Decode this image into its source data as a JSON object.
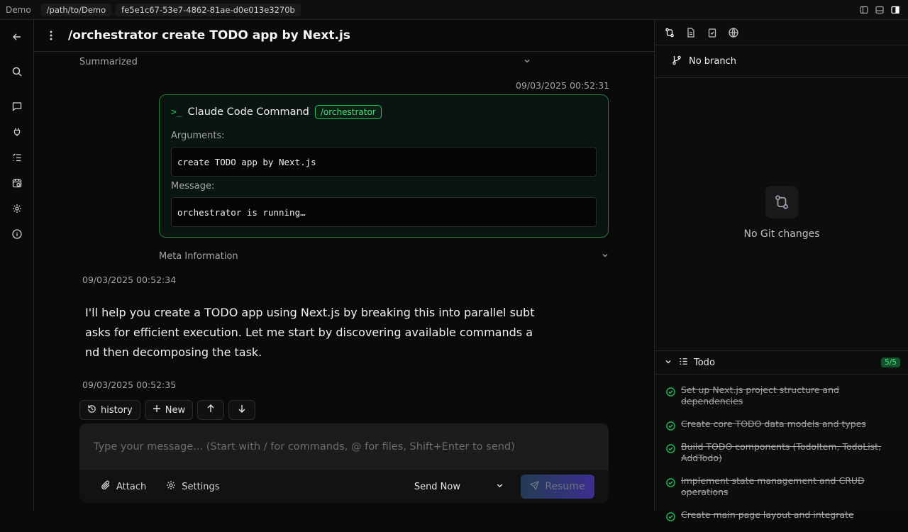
{
  "topbar": {
    "app_name": "Demo",
    "path": "/path/to/Demo",
    "session_id": "fe5e1c67-53e7-4862-81ae-d0e013e3270b"
  },
  "header": {
    "title": "/orchestrator create TODO app by Next.js"
  },
  "thread": {
    "summarized_label": "Summarized",
    "command_timestamp": "09/03/2025 00:52:31",
    "command": {
      "title": "Claude Code Command",
      "badge": "/orchestrator",
      "arguments_label": "Arguments:",
      "arguments": "create TODO app by Next.js",
      "message_label": "Message:",
      "message": "orchestrator is running…"
    },
    "meta_label": "Meta Information",
    "assistant_timestamp": "09/03/2025 00:52:34",
    "assistant_text": "I'll help you create a TODO app using Next.js by breaking this into parallel subtasks for efficient execution. Let me start by discovering available commands and then decomposing the task.",
    "last_timestamp": "09/03/2025 00:52:35"
  },
  "controls": {
    "history_label": "history",
    "new_label": "New"
  },
  "composer": {
    "placeholder": "Type your message... (Start with / for commands, @ for files, Shift+Enter to send)",
    "attach_label": "Attach",
    "settings_label": "Settings",
    "send_mode": "Send Now",
    "resume_label": "Resume"
  },
  "side": {
    "branch": "No branch",
    "empty_text": "No Git changes",
    "todo_label": "Todo",
    "todo_count": "5/5",
    "todos": [
      "Set up Next.js project structure and dependencies",
      "Create core TODO data models and types",
      "Build TODO components (TodoItem, TodoList, AddTodo)",
      "Implement state management and CRUD operations",
      "Create main page layout and integrate"
    ]
  },
  "colors": {
    "accent_green": "#22c55e",
    "background": "#0a0a0a"
  }
}
